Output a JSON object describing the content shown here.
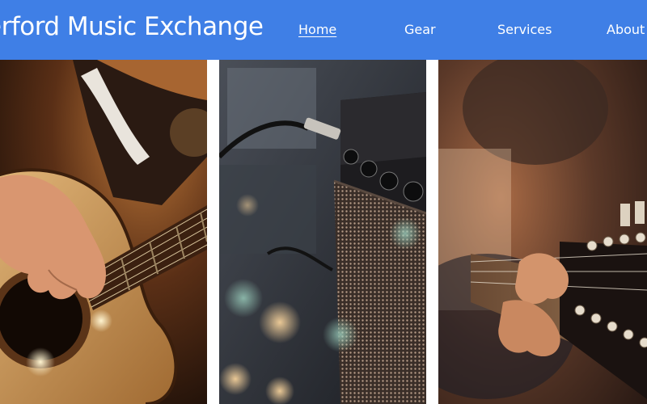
{
  "site": {
    "title": "erford Music Exchange"
  },
  "nav": {
    "items": [
      {
        "label": "Home",
        "active": true
      },
      {
        "label": "Gear",
        "active": false
      },
      {
        "label": "Services",
        "active": false
      },
      {
        "label": "About",
        "active": false
      }
    ]
  },
  "colors": {
    "header_bg": "#3f7fe6",
    "nav_text": "#ffffff"
  }
}
